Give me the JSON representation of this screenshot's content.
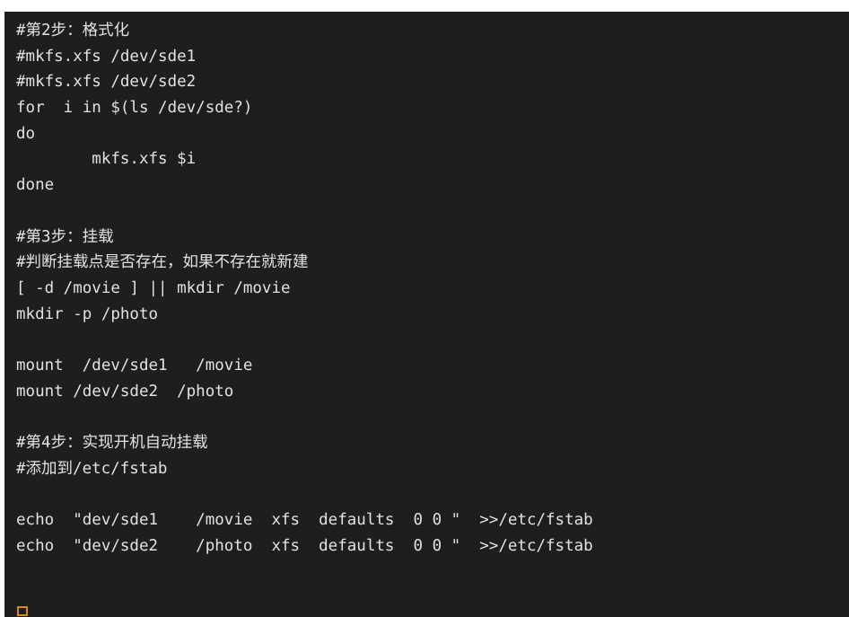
{
  "editor": {
    "kind": "shell-script-editor",
    "background_color": "#1e1e1e",
    "text_color": "#e2e2e2",
    "cursor_color": "#d08b22",
    "font_size_px": 17.5,
    "line_height_px": 28.7,
    "line_count": 21
  },
  "code": {
    "language": "bash",
    "lines": [
      "#第2步：格式化",
      "#mkfs.xfs /dev/sde1",
      "#mkfs.xfs /dev/sde2",
      "for  i in $(ls /dev/sde?)",
      "do",
      "        mkfs.xfs $i",
      "done",
      "",
      "#第3步：挂载",
      "#判断挂载点是否存在，如果不存在就新建",
      "[ -d /movie ] || mkdir /movie",
      "mkdir -p /photo",
      "",
      "mount  /dev/sde1   /movie",
      "mount /dev/sde2  /photo",
      "",
      "#第4步：实现开机自动挂载",
      "#添加到/etc/fstab",
      "",
      "echo  \"dev/sde1    /movie  xfs  defaults  0 0 \"  >>/etc/fstab",
      "echo  \"dev/sde2    /photo  xfs  defaults  0 0 \"  >>/etc/fstab"
    ]
  },
  "cursor": {
    "shape": "hollow-block",
    "column": 1,
    "row": 22
  }
}
